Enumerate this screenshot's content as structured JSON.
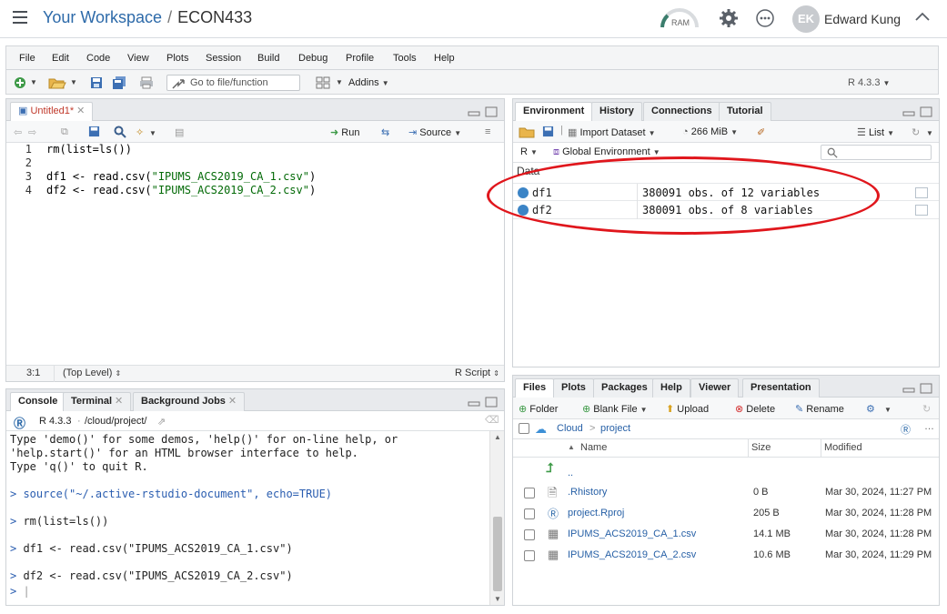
{
  "header": {
    "workspace": "Your Workspace",
    "separator": "/",
    "project": "ECON433",
    "ram_label": "RAM",
    "avatar_initials": "EK",
    "user_name": "Edward Kung"
  },
  "menu": [
    "File",
    "Edit",
    "Code",
    "View",
    "Plots",
    "Session",
    "Build",
    "Debug",
    "Profile",
    "Tools",
    "Help"
  ],
  "toolbar": {
    "goto_placeholder": "Go to file/function",
    "addins_label": "Addins",
    "r_version": "R 4.3.3"
  },
  "source": {
    "tab_label": "Untitled1*",
    "run_label": "Run",
    "source_label": "Source",
    "lines": [
      {
        "num": "1",
        "pre": "rm(list=ls())",
        "str": "",
        "post": ""
      },
      {
        "num": "2",
        "pre": "",
        "str": "",
        "post": ""
      },
      {
        "num": "3",
        "pre": "df1 <- read.csv(",
        "str": "\"IPUMS_ACS2019_CA_1.csv\"",
        "post": ")"
      },
      {
        "num": "4",
        "pre": "df2 <- read.csv(",
        "str": "\"IPUMS_ACS2019_CA_2.csv\"",
        "post": ")"
      }
    ],
    "status_pos": "3:1",
    "status_scope": "(Top Level)",
    "status_type": "R Script"
  },
  "console": {
    "tabs": [
      "Console",
      "Terminal",
      "Background Jobs"
    ],
    "r_version": "R 4.3.3",
    "path": "/cloud/project/",
    "lines": [
      {
        "prompt": "",
        "text": "Type 'demo()' for some demos, 'help()' for on-line help, or"
      },
      {
        "prompt": "",
        "text": "'help.start()' for an HTML browser interface to help."
      },
      {
        "prompt": "",
        "text": "Type 'q()' to quit R."
      },
      {
        "prompt": ">",
        "text": " source(\"~/.active-rstudio-document\", echo=TRUE)"
      },
      {
        "prompt": ">",
        "text": " rm(list=ls())"
      },
      {
        "prompt": ">",
        "text": " df1 <- read.csv(\"IPUMS_ACS2019_CA_1.csv\")"
      },
      {
        "prompt": ">",
        "text": " df2 <- read.csv(\"IPUMS_ACS2019_CA_2.csv\")"
      },
      {
        "prompt": ">",
        "text": " |"
      }
    ]
  },
  "environment": {
    "tabs": [
      "Environment",
      "History",
      "Connections",
      "Tutorial"
    ],
    "import_label": "Import Dataset",
    "memory": "266 MiB",
    "view_mode": "List",
    "lang": "R",
    "scope": "Global Environment",
    "data_header": "Data",
    "rows": [
      {
        "name": "df1",
        "value": "380091 obs. of 12 variables"
      },
      {
        "name": "df2",
        "value": "380091 obs. of 8 variables"
      }
    ]
  },
  "files": {
    "tabs": [
      "Files",
      "Plots",
      "Packages",
      "Help",
      "Viewer",
      "Presentation"
    ],
    "actions": {
      "folder": "Folder",
      "blank": "Blank File",
      "upload": "Upload",
      "delete": "Delete",
      "rename": "Rename"
    },
    "breadcrumb_root": "Cloud",
    "breadcrumb_sep": ">",
    "breadcrumb_dir": "project",
    "columns": {
      "name": "Name",
      "size": "Size",
      "modified": "Modified"
    },
    "up_label": "..",
    "rows": [
      {
        "name": ".Rhistory",
        "size": "0 B",
        "modified": "Mar 30, 2024, 11:27 PM",
        "icon": "text-file-icon"
      },
      {
        "name": "project.Rproj",
        "size": "205 B",
        "modified": "Mar 30, 2024, 11:28 PM",
        "icon": "rproj-icon"
      },
      {
        "name": "IPUMS_ACS2019_CA_1.csv",
        "size": "14.1 MB",
        "modified": "Mar 30, 2024, 11:28 PM",
        "icon": "csv-icon"
      },
      {
        "name": "IPUMS_ACS2019_CA_2.csv",
        "size": "10.6 MB",
        "modified": "Mar 30, 2024, 11:29 PM",
        "icon": "csv-icon"
      }
    ]
  },
  "colors": {
    "accent": "#2d6aa9",
    "annotation": "#e0161c",
    "string": "#036a07"
  }
}
